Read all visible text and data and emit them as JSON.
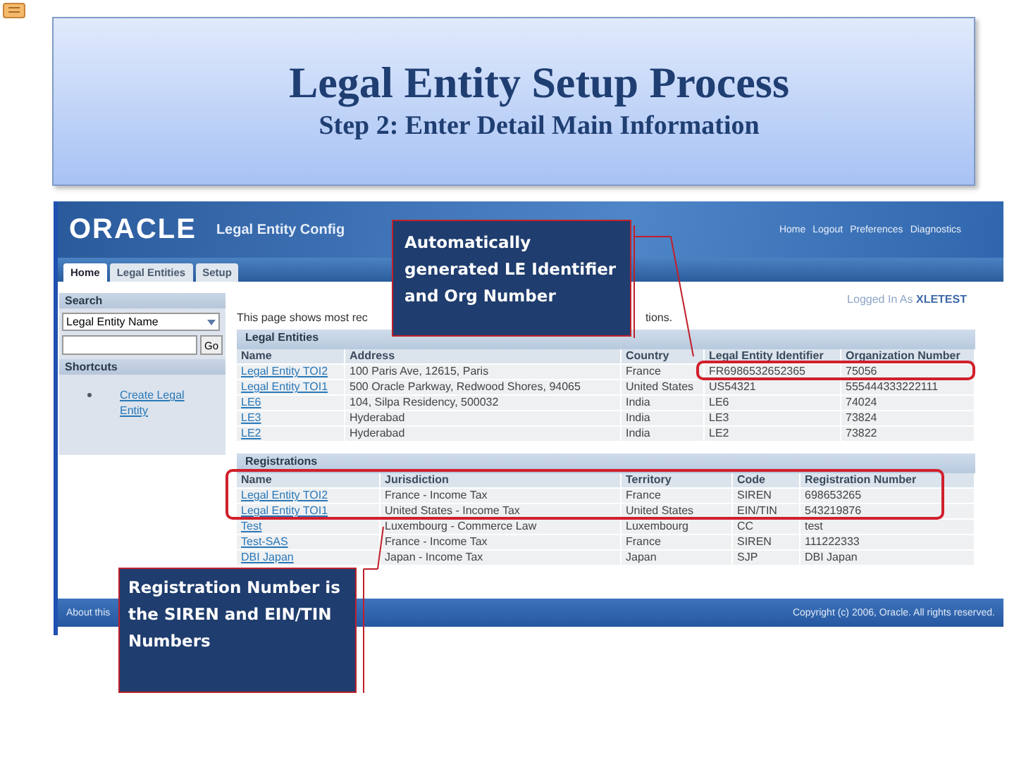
{
  "slide": {
    "title": "Legal Entity Setup Process",
    "subtitle": "Step 2: Enter Detail Main Information"
  },
  "app": {
    "logo": "ORACLE",
    "app_title": "Legal Entity Config",
    "global_links": [
      "Home",
      "Logout",
      "Preferences",
      "Diagnostics"
    ],
    "tabs": [
      {
        "label": "Home",
        "selected": true
      },
      {
        "label": "Legal Entities",
        "selected": false
      },
      {
        "label": "Setup",
        "selected": false
      }
    ],
    "logged_in": {
      "prefix": "Logged In As",
      "user": "XLETEST"
    },
    "sidebar": {
      "search_heading": "Search",
      "select_value": "Legal Entity Name",
      "go_button": "Go",
      "shortcuts_heading": "Shortcuts",
      "shortcuts": [
        "Create Legal Entity"
      ]
    },
    "intro": [
      "This page shows most rec",
      "tions."
    ],
    "legal_entities": {
      "title": "Legal Entities",
      "columns": [
        "Name",
        "Address",
        "Country",
        "Legal Entity Identifier",
        "Organization Number"
      ],
      "rows": [
        [
          "Legal Entity TOI2",
          "100 Paris Ave, 12615, Paris",
          "France",
          "FR6986532652365",
          "75056"
        ],
        [
          "Legal Entity TOI1",
          "500 Oracle Parkway, Redwood Shores, 94065",
          "United States",
          "US54321",
          "555444333222111"
        ],
        [
          "LE6",
          "104, Silpa Residency, 500032",
          "India",
          "LE6",
          "74024"
        ],
        [
          "LE3",
          "Hyderabad",
          "India",
          "LE3",
          "73824"
        ],
        [
          "LE2",
          "Hyderabad",
          "India",
          "LE2",
          "73822"
        ]
      ]
    },
    "registrations": {
      "title": "Registrations",
      "columns": [
        "Name",
        "Jurisdiction",
        "Territory",
        "Code",
        "Registration Number"
      ],
      "rows": [
        [
          "Legal Entity TOI2",
          "France - Income Tax",
          "France",
          "SIREN",
          "698653265"
        ],
        [
          "Legal Entity TOI1",
          "United States - Income Tax",
          "United States",
          "EIN/TIN",
          "543219876"
        ],
        [
          "Test",
          "Luxembourg - Commerce Law",
          "Luxembourg",
          "CC",
          "test"
        ],
        [
          "Test-SAS",
          "France - Income Tax",
          "France",
          "SIREN",
          "111222333"
        ],
        [
          "DBI Japan",
          "Japan - Income Tax",
          "Japan",
          "SJP",
          "DBI Japan"
        ]
      ]
    },
    "footer": {
      "about": "About this",
      "copyright": "Copyright (c) 2006, Oracle. All rights reserved."
    }
  },
  "callouts": [
    {
      "text": "Automatically generated LE Identifier and Org Number"
    },
    {
      "text": "Registration Number is the SIREN and EIN/TIN Numbers"
    }
  ]
}
